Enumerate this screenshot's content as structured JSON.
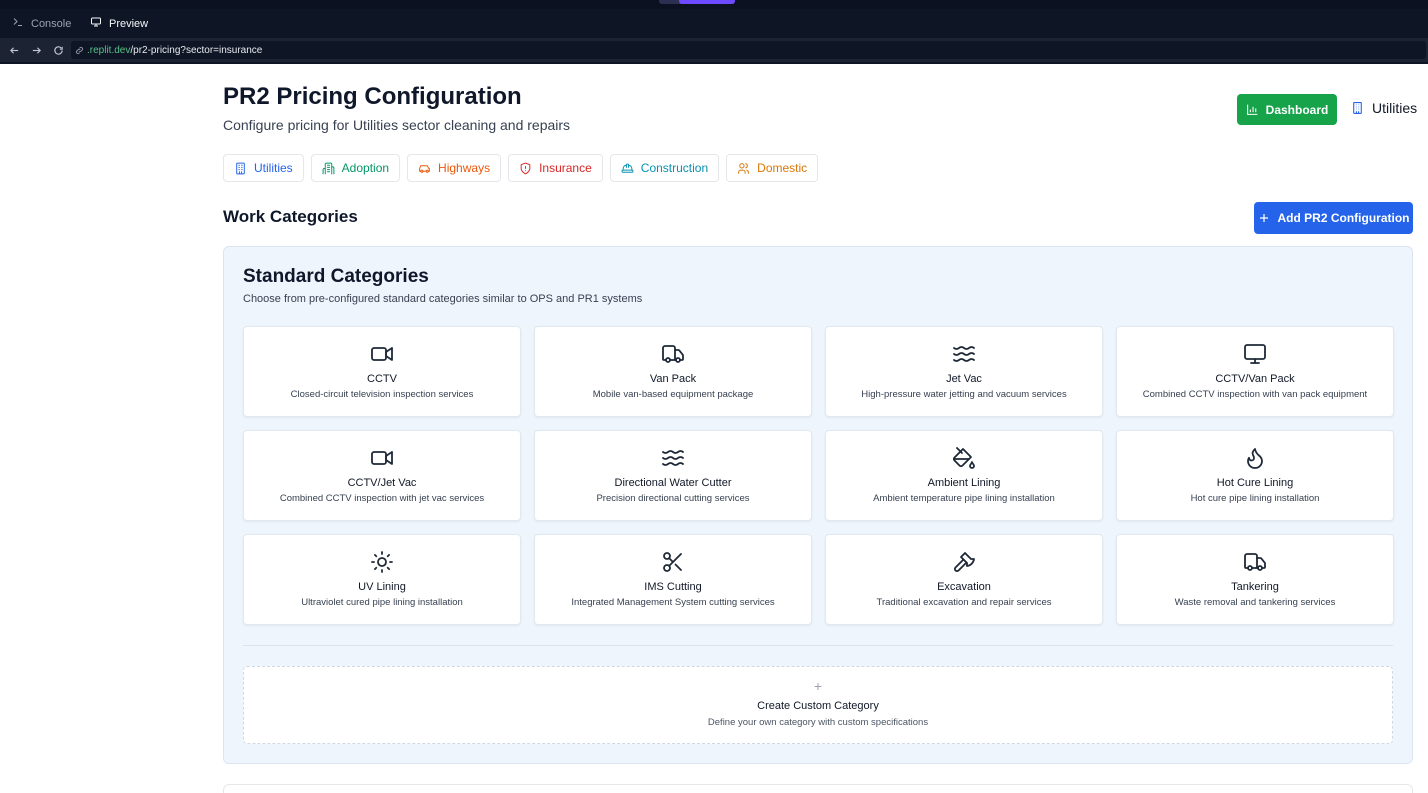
{
  "browser": {
    "tabs": [
      {
        "label": "Console",
        "icon": "terminal-icon",
        "active": false
      },
      {
        "label": "Preview",
        "icon": "monitor-icon",
        "active": true
      }
    ],
    "url_host": ".replit.dev",
    "url_path": "/pr2-pricing?sector=insurance"
  },
  "header": {
    "title": "PR2 Pricing Configuration",
    "subtitle": "Configure pricing for Utilities sector cleaning and repairs",
    "dashboard_label": "Dashboard",
    "current_sector": "Utilities"
  },
  "sectors": [
    {
      "label": "Utilities",
      "icon": "building-icon",
      "color": "#2563eb"
    },
    {
      "label": "Adoption",
      "icon": "building-2-icon",
      "color": "#059669"
    },
    {
      "label": "Highways",
      "icon": "car-icon",
      "color": "#ea580c"
    },
    {
      "label": "Insurance",
      "icon": "shield-icon",
      "color": "#dc2626"
    },
    {
      "label": "Construction",
      "icon": "hard-hat-icon",
      "color": "#0891b2"
    },
    {
      "label": "Domestic",
      "icon": "users-icon",
      "color": "#d97706"
    }
  ],
  "work_categories": {
    "title": "Work Categories",
    "add_label": "Add PR2 Configuration"
  },
  "standard": {
    "title": "Standard Categories",
    "subtitle": "Choose from pre-configured standard categories similar to OPS and PR1 systems",
    "items": [
      {
        "name": "CCTV",
        "desc": "Closed-circuit television inspection services",
        "icon": "video-icon"
      },
      {
        "name": "Van Pack",
        "desc": "Mobile van-based equipment package",
        "icon": "truck-icon"
      },
      {
        "name": "Jet Vac",
        "desc": "High-pressure water jetting and vacuum services",
        "icon": "waves-icon"
      },
      {
        "name": "CCTV/Van Pack",
        "desc": "Combined CCTV inspection with van pack equipment",
        "icon": "monitor-icon"
      },
      {
        "name": "CCTV/Jet Vac",
        "desc": "Combined CCTV inspection with jet vac services",
        "icon": "video-icon"
      },
      {
        "name": "Directional Water Cutter",
        "desc": "Precision directional cutting services",
        "icon": "waves-icon"
      },
      {
        "name": "Ambient Lining",
        "desc": "Ambient temperature pipe lining installation",
        "icon": "paint-bucket-icon"
      },
      {
        "name": "Hot Cure Lining",
        "desc": "Hot cure pipe lining installation",
        "icon": "flame-icon"
      },
      {
        "name": "UV Lining",
        "desc": "Ultraviolet cured pipe lining installation",
        "icon": "sun-icon"
      },
      {
        "name": "IMS Cutting",
        "desc": "Integrated Management System cutting services",
        "icon": "scissors-icon"
      },
      {
        "name": "Excavation",
        "desc": "Traditional excavation and repair services",
        "icon": "pickaxe-icon"
      },
      {
        "name": "Tankering",
        "desc": "Waste removal and tankering services",
        "icon": "truck-icon"
      }
    ],
    "custom": {
      "plus": "+",
      "name": "Create Custom Category",
      "desc": "Define your own category with custom specifications"
    }
  },
  "colors": {
    "dashboard_button": "#16a34a",
    "add_button": "#2563eb",
    "panel_bg": "#eff5fd"
  }
}
